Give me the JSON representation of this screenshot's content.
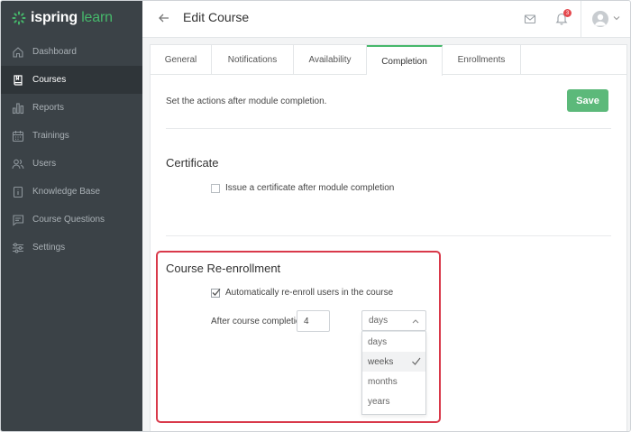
{
  "app": {
    "logo_main": "ispring",
    "logo_accent": "learn",
    "logo_icon": "ispring-flower-icon"
  },
  "sidebar": {
    "items": [
      {
        "label": "Dashboard",
        "icon": "home-icon",
        "active": false
      },
      {
        "label": "Courses",
        "icon": "book-icon",
        "active": true
      },
      {
        "label": "Reports",
        "icon": "bar-chart-icon",
        "active": false
      },
      {
        "label": "Trainings",
        "icon": "calendar-icon",
        "active": false
      },
      {
        "label": "Users",
        "icon": "users-icon",
        "active": false
      },
      {
        "label": "Knowledge Base",
        "icon": "info-book-icon",
        "active": false
      },
      {
        "label": "Course Questions",
        "icon": "chat-icon",
        "active": false
      },
      {
        "label": "Settings",
        "icon": "sliders-icon",
        "active": false
      }
    ]
  },
  "header": {
    "title": "Edit Course",
    "notification_count": "3"
  },
  "tabs": [
    {
      "label": "General",
      "active": false
    },
    {
      "label": "Notifications",
      "active": false
    },
    {
      "label": "Availability",
      "active": false
    },
    {
      "label": "Completion",
      "active": true
    },
    {
      "label": "Enrollments",
      "active": false
    }
  ],
  "completion": {
    "intro": "Set the actions after module completion.",
    "save_label": "Save",
    "certificate": {
      "title": "Certificate",
      "checkbox_label": "Issue a certificate after module completion",
      "checked": false
    },
    "reenrollment": {
      "title": "Course Re-enrollment",
      "checkbox_label": "Automatically re-enroll users in the course",
      "checked": true,
      "after_label": "After course completion in:",
      "period_value": "4",
      "unit_selected_display": "days",
      "unit_options": [
        "days",
        "weeks",
        "months",
        "years"
      ],
      "unit_checked": "weeks"
    }
  },
  "colors": {
    "sidebar_bg": "#3b4247",
    "accent_green": "#46b86b",
    "save_button": "#5cb97a",
    "highlight_red": "#d9394a",
    "badge_red": "#e5484d"
  }
}
